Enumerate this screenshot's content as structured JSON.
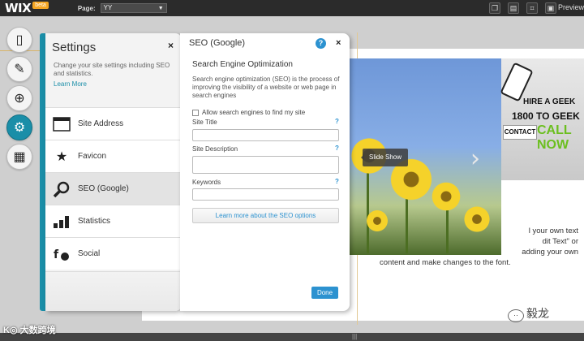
{
  "topbar": {
    "logo": "WIX",
    "beta_badge": "beta",
    "page_label": "Page:",
    "page_value": "YY",
    "preview_label": "Preview",
    "icons": [
      "copy-icon",
      "page-icon",
      "crop-icon",
      "monitor-icon"
    ]
  },
  "left_rail": {
    "items": [
      {
        "icon": "page-icon",
        "active": false
      },
      {
        "icon": "brush-icon",
        "active": false
      },
      {
        "icon": "plus-icon",
        "active": false
      },
      {
        "icon": "gear-icon",
        "active": true
      },
      {
        "icon": "store-icon",
        "active": false
      }
    ]
  },
  "settings": {
    "title": "Settings",
    "close": "×",
    "description": "Change your site settings including SEO and statistics.",
    "learn_more": "Learn More",
    "items": [
      {
        "label": "Site Address",
        "icon": "browser-window-icon"
      },
      {
        "label": "Favicon",
        "icon": "star-icon"
      },
      {
        "label": "SEO (Google)",
        "icon": "magnifier-icon",
        "selected": true
      },
      {
        "label": "Statistics",
        "icon": "bar-chart-icon"
      },
      {
        "label": "Social",
        "icon": "social-icon"
      }
    ]
  },
  "seo": {
    "title": "SEO (Google)",
    "help": "?",
    "close": "×",
    "heading": "Search Engine Optimization",
    "description": "Search engine optimization (SEO) is the process of improving the visibility of a website or web page in search engines",
    "allow_label": "Allow search engines to find my site",
    "site_title_label": "Site Title",
    "site_description_label": "Site Description",
    "keywords_label": "Keywords",
    "field_help": "?",
    "learn_more_button": "Learn more about the SEO options",
    "done_button": "Done"
  },
  "site": {
    "slideshow_tag": "Slide Show",
    "ad_line1": "HIRE A GEEK",
    "ad_line2": "1800 TO GEEK",
    "ad_line3": "CALL NOW",
    "contact": "CONTACT",
    "text_line1": "l your own text",
    "text_line2": "dit Text\" or",
    "text_line3": "adding your own",
    "text_line4": "content and make changes to the font."
  },
  "watermarks": {
    "left": "K◎ 大数跨境",
    "right": "毅龙"
  },
  "colors": {
    "accent": "#1a8ea8",
    "button_blue": "#2c92d0",
    "topbar": "#2b2b2b",
    "ad_green": "#6bbf1f"
  }
}
